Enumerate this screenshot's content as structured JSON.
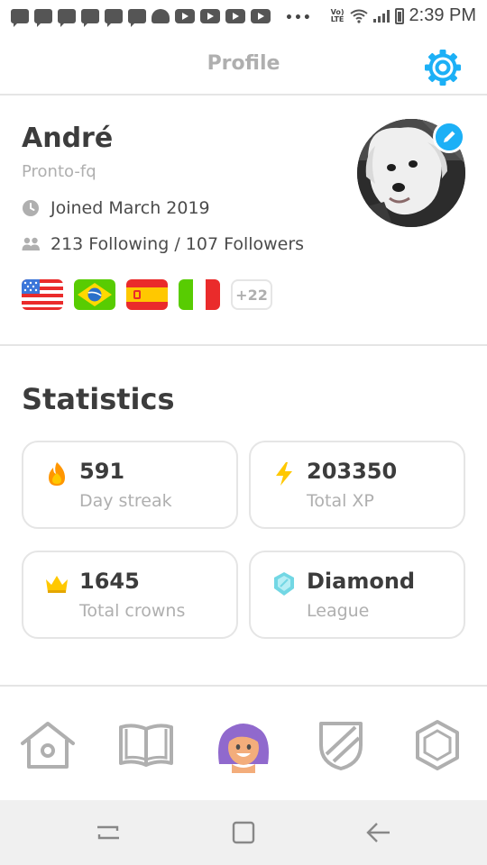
{
  "status_bar": {
    "time": "2:39 PM",
    "volte_line1": "Vo)",
    "volte_line2": "LTE",
    "overflow": "•••"
  },
  "header": {
    "title": "Profile",
    "settings_icon": "gear-icon",
    "accent_color": "#1cb0f6"
  },
  "profile": {
    "name": "André",
    "username": "Pronto-fq",
    "joined": "Joined March 2019",
    "follow": "213 Following / 107 Followers",
    "flags": [
      "us-flag",
      "brazil-flag",
      "spain-flag",
      "italy-flag"
    ],
    "more_courses": "+22"
  },
  "statistics": {
    "title": "Statistics",
    "cards": [
      {
        "value": "591",
        "label": "Day streak",
        "icon": "fire-icon"
      },
      {
        "value": "203350",
        "label": "Total XP",
        "icon": "lightning-icon"
      },
      {
        "value": "1645",
        "label": "Total crowns",
        "icon": "crown-icon"
      },
      {
        "value": "Diamond",
        "label": "League",
        "icon": "diamond-league-icon"
      }
    ]
  },
  "tabs": [
    "home-icon",
    "book-icon",
    "profile-avatar-icon",
    "shield-icon",
    "store-icon"
  ],
  "colors": {
    "streak": "#ff9600",
    "xp": "#ffc800",
    "crown": "#ffc800",
    "league": "#72d7e4",
    "avatar_hair": "#9069cd"
  }
}
